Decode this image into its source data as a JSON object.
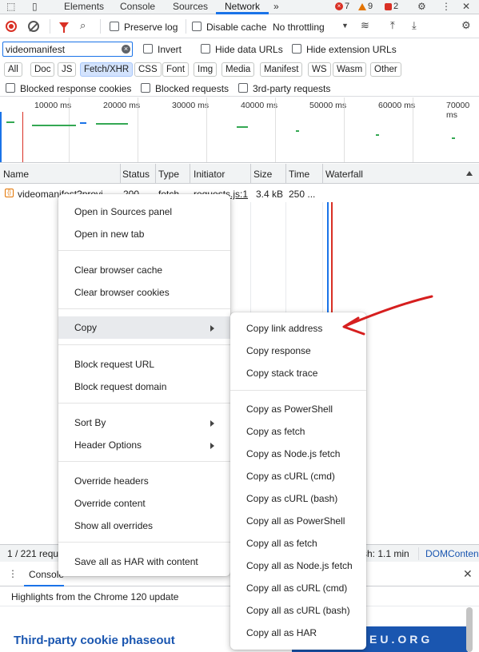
{
  "tabs": {
    "items": [
      "Elements",
      "Console",
      "Sources",
      "Network"
    ],
    "active": "Network",
    "more": "»",
    "errors": "7",
    "warnings": "9",
    "issues": "2"
  },
  "toolbar": {
    "preserve_log": "Preserve log",
    "disable_cache": "Disable cache",
    "throttling": "No throttling"
  },
  "filter": {
    "value": "videomanifest",
    "invert": "Invert",
    "hide_data_urls": "Hide data URLs",
    "hide_extension_urls": "Hide extension URLs"
  },
  "types": [
    "All",
    "Doc",
    "JS",
    "Fetch/XHR",
    "CSS",
    "Font",
    "Img",
    "Media",
    "Manifest",
    "WS",
    "Wasm",
    "Other"
  ],
  "active_type": "Fetch/XHR",
  "block": {
    "blocked_cookies": "Blocked response cookies",
    "blocked_requests": "Blocked requests",
    "third_party": "3rd-party requests"
  },
  "overview": {
    "ticks": [
      "10000 ms",
      "20000 ms",
      "30000 ms",
      "40000 ms",
      "50000 ms",
      "60000 ms",
      "70000 ms"
    ]
  },
  "columns": {
    "name": "Name",
    "status": "Status",
    "type": "Type",
    "initiator": "Initiator",
    "size": "Size",
    "time": "Time",
    "waterfall": "Waterfall"
  },
  "request": {
    "name": "videomanifest?provi",
    "status": "200",
    "type": "fetch",
    "initiator": "requests.js:1",
    "size": "3.4 kB",
    "time": "250 ..."
  },
  "statusbar": {
    "left": "1 / 221 requ",
    "finish": "sh: 1.1 min",
    "dom": "DOMConten"
  },
  "drawer": {
    "tab": "Console",
    "highlights": "Highlights from the Chrome 120 update",
    "cookie_title": "Third-party cookie phaseout",
    "promo": "HIEU.ORG"
  },
  "context_menu": {
    "groups": [
      [
        "Open in Sources panel",
        "Open in new tab"
      ],
      [
        "Clear browser cache",
        "Clear browser cookies"
      ],
      [
        "Copy"
      ],
      [
        "Block request URL",
        "Block request domain"
      ],
      [
        "Sort By",
        "Header Options"
      ],
      [
        "Override headers",
        "Override content",
        "Show all overrides"
      ],
      [
        "Save all as HAR with content"
      ]
    ]
  },
  "copy_submenu": {
    "groups": [
      [
        "Copy link address",
        "Copy response",
        "Copy stack trace"
      ],
      [
        "Copy as PowerShell",
        "Copy as fetch",
        "Copy as Node.js fetch",
        "Copy as cURL (cmd)",
        "Copy as cURL (bash)",
        "Copy all as PowerShell",
        "Copy all as fetch",
        "Copy all as Node.js fetch",
        "Copy all as cURL (cmd)",
        "Copy all as cURL (bash)",
        "Copy all as HAR"
      ]
    ]
  },
  "colors": {
    "accent": "#1a73e8",
    "error": "#d93025",
    "annotation": "#d61f1f"
  }
}
